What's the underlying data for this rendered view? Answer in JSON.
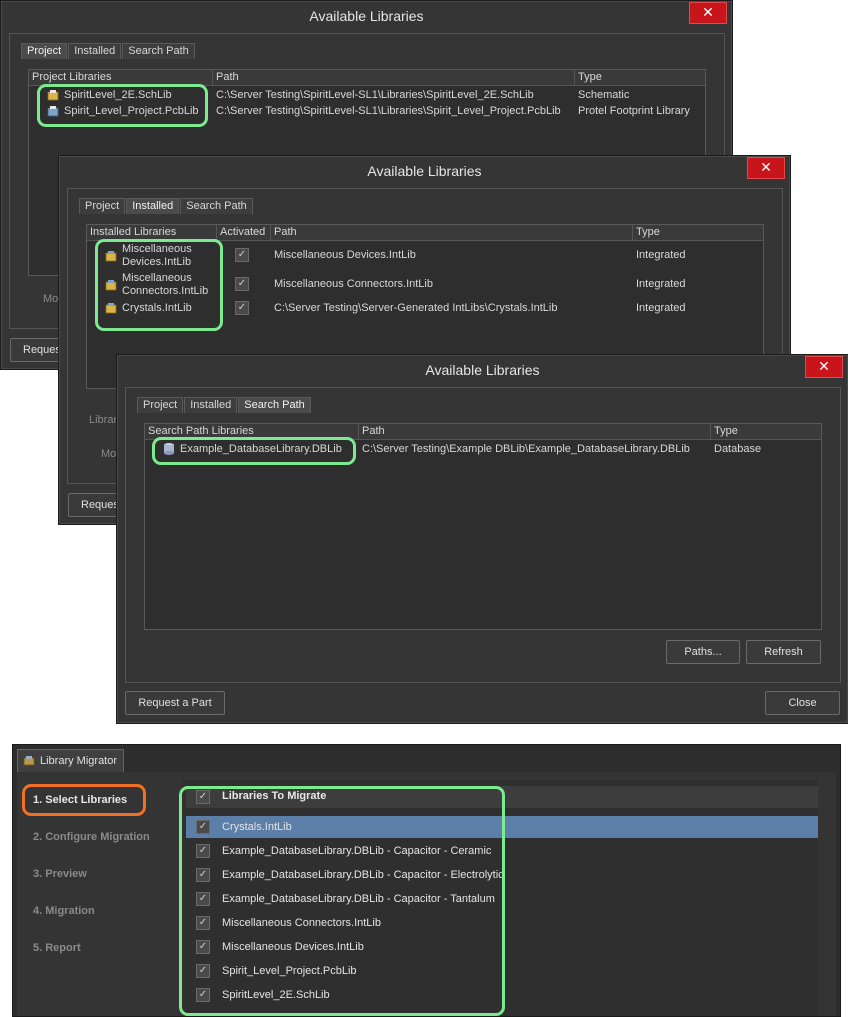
{
  "dialog1": {
    "title": "Available Libraries",
    "close_x": "✕",
    "tabs": [
      "Project",
      "Installed",
      "Search Path"
    ],
    "columns": [
      "Project Libraries",
      "Path",
      "Type"
    ],
    "rows": [
      {
        "name": "SpiritLevel_2E.SchLib",
        "path": "C:\\Server Testing\\SpiritLevel-SL1\\Libraries\\SpiritLevel_2E.SchLib",
        "type": "Schematic"
      },
      {
        "name": "Spirit_Level_Project.PcbLib",
        "path": "C:\\Server Testing\\SpiritLevel-SL1\\Libraries\\Spirit_Level_Project.PcbLib",
        "type": "Protel Footprint Library"
      }
    ],
    "ghost_move": "Mo",
    "ghost_request": "Reques"
  },
  "dialog2": {
    "title": "Available Libraries",
    "close_x": "✕",
    "tabs": [
      "Project",
      "Installed",
      "Search Path"
    ],
    "columns": [
      "Installed Libraries",
      "Activated",
      "Path",
      "Type"
    ],
    "rows": [
      {
        "name1": "Miscellaneous",
        "name2": "Devices.IntLib",
        "check": "✓",
        "path": "Miscellaneous Devices.IntLib",
        "type": "Integrated"
      },
      {
        "name1": "Miscellaneous",
        "name2": "Connectors.IntLib",
        "check": "✓",
        "path": "Miscellaneous Connectors.IntLib",
        "type": "Integrated"
      },
      {
        "name1": "Crystals.IntLib",
        "name2": "",
        "check": "✓",
        "path": "C:\\Server Testing\\Server-Generated IntLibs\\Crystals.IntLib",
        "type": "Integrated"
      }
    ],
    "ghost_library": "Librar",
    "ghost_move": "Mo",
    "ghost_request": "Reques"
  },
  "dialog3": {
    "title": "Available Libraries",
    "close_x": "✕",
    "tabs": [
      "Project",
      "Installed",
      "Search Path"
    ],
    "columns": [
      "Search Path Libraries",
      "Path",
      "Type"
    ],
    "rows": [
      {
        "name": "Example_DatabaseLibrary.DBLib",
        "path": "C:\\Server Testing\\Example DBLib\\Example_DatabaseLibrary.DBLib",
        "type": "Database"
      }
    ],
    "paths_button": "Paths...",
    "refresh_button": "Refresh",
    "request_button": "Request a Part",
    "close_button": "Close"
  },
  "migrator": {
    "tab_label": "Library Migrator",
    "steps": [
      "1. Select Libraries",
      "2. Configure Migration",
      "3. Preview",
      "4. Migration",
      "5. Report"
    ],
    "header_label": "Libraries To Migrate",
    "header_check": "✓",
    "items": [
      {
        "label": "Crystals.IntLib",
        "check": "✓"
      },
      {
        "label": "Example_DatabaseLibrary.DBLib - Capacitor - Ceramic",
        "check": "✓"
      },
      {
        "label": "Example_DatabaseLibrary.DBLib - Capacitor - Electrolytic",
        "check": "✓"
      },
      {
        "label": "Example_DatabaseLibrary.DBLib - Capacitor - Tantalum",
        "check": "✓"
      },
      {
        "label": "Miscellaneous Connectors.IntLib",
        "check": "✓"
      },
      {
        "label": "Miscellaneous Devices.IntLib",
        "check": "✓"
      },
      {
        "label": "Spirit_Level_Project.PcbLib",
        "check": "✓"
      },
      {
        "label": "SpiritLevel_2E.SchLib",
        "check": "✓"
      }
    ]
  },
  "colors": {
    "highlight_green": "#7dea8f",
    "highlight_orange": "#f36f21",
    "close_red": "#c8151b",
    "selected_row": "#5b7fa8"
  }
}
